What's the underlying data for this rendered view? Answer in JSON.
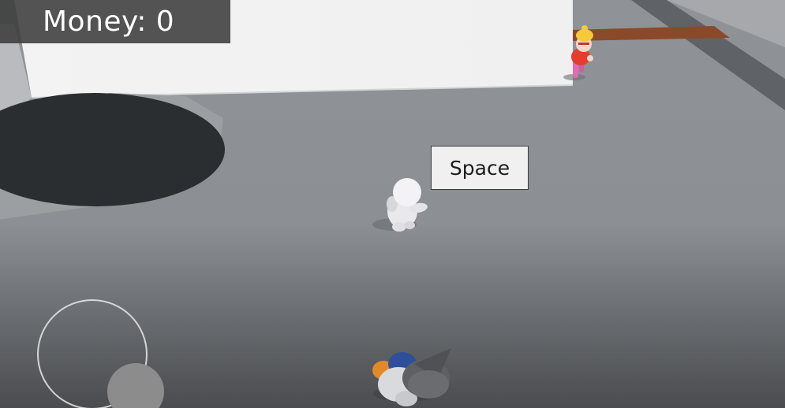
{
  "hud": {
    "money_label": "Money: 0"
  },
  "action_button": {
    "label": "Space"
  },
  "joystick": {
    "ring_icon": "joystick-ring",
    "knob_icon": "joystick-knob"
  },
  "colors": {
    "floor": "#8e9296",
    "wall": "#f2f2f2",
    "pit": "#2b2e31",
    "hud_panel": "#3c3c3c",
    "red_shirt": "#e63b2e",
    "pink_pants": "#e46ab4",
    "yellow_hat": "#f5c93a",
    "blue_shirt": "#2f4f9a",
    "orange_hair": "#e08a2a",
    "hat_gray": "#5e6064"
  }
}
